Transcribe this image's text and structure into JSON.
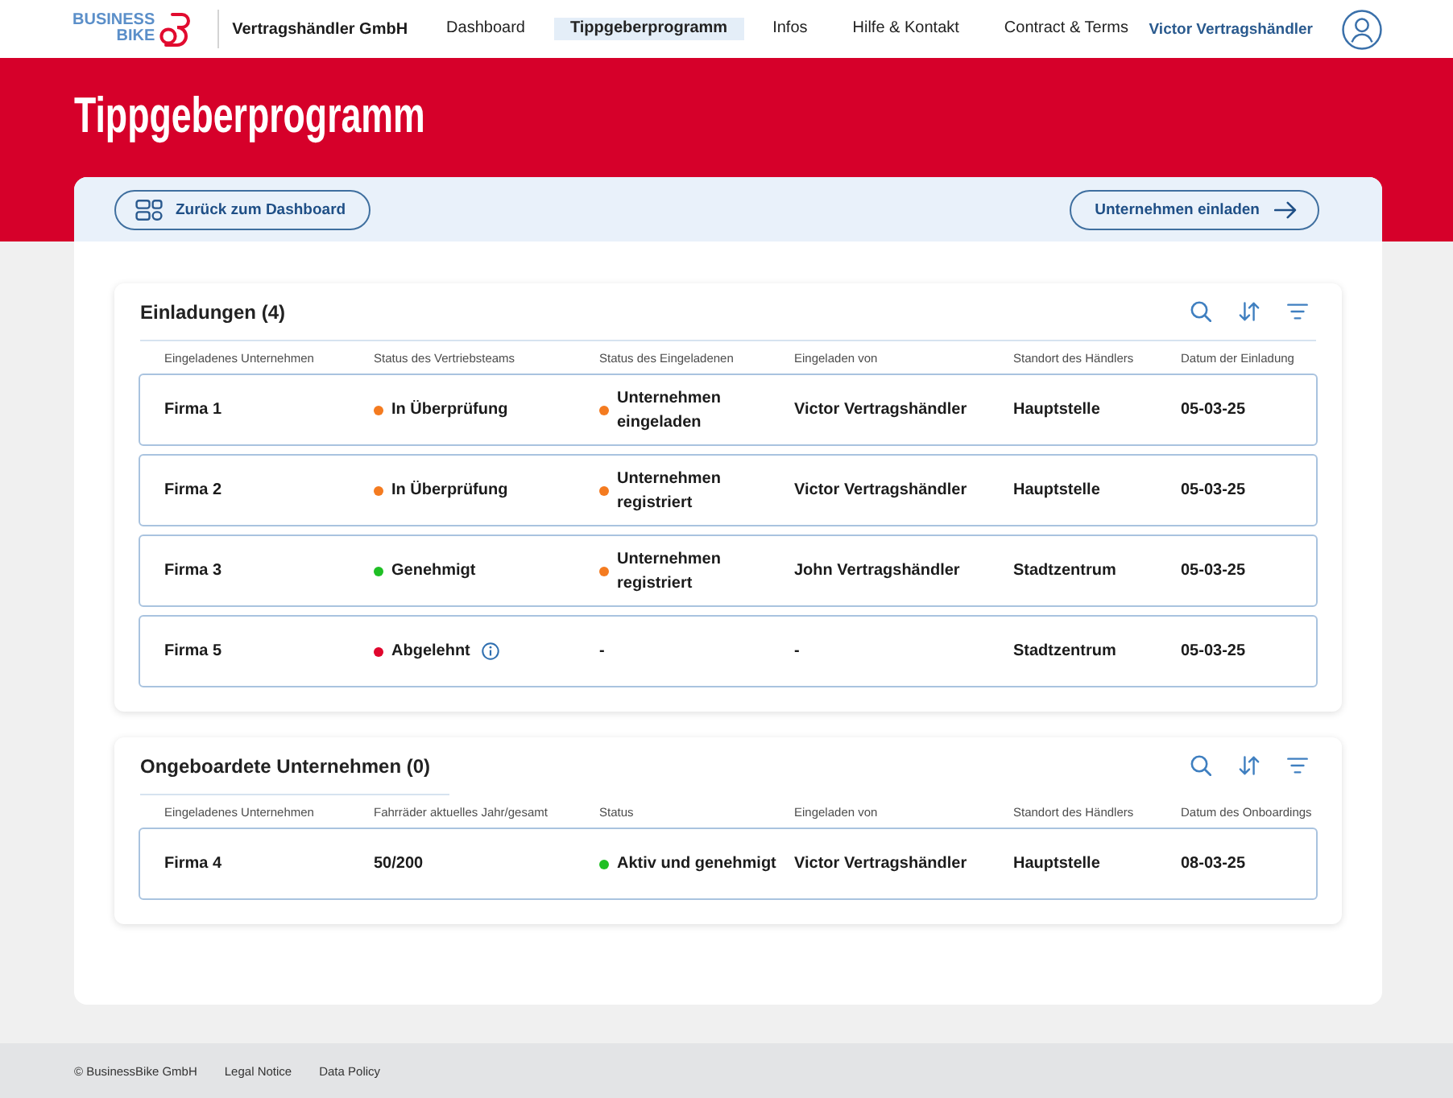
{
  "header": {
    "logo": {
      "lines": [
        "BUSINESS",
        "BIKE"
      ]
    },
    "company": "Vertragshändler GmbH",
    "nav": [
      {
        "label": "Dashboard",
        "selected": false
      },
      {
        "label": "Tippgeberprogramm",
        "selected": true
      },
      {
        "label": "Infos",
        "selected": false
      },
      {
        "label": "Hilfe & Kontakt",
        "selected": false
      },
      {
        "label": "Contract & Terms",
        "selected": false
      }
    ],
    "user": "Victor Vertragshändler"
  },
  "page_title": "Tippgeberprogramm",
  "toolbar": {
    "back_button": "Zurück zum Dashboard",
    "invite_button": "Unternehmen einladen"
  },
  "sections": [
    {
      "title": "Einladungen (4)",
      "columns": [
        "Eingeladenes Unternehmen",
        "Status des Vertriebsteams",
        "Status des Eingeladenen",
        "Eingeladen von",
        "Standort des Händlers",
        "Datum der Einladung"
      ],
      "rows": [
        {
          "cells": [
            {
              "kind": "text",
              "text": "Firma 1"
            },
            {
              "kind": "status",
              "text": "In Überprüfung",
              "color": "#f47b20",
              "info": false
            },
            {
              "kind": "status",
              "text": "Unternehmen eingeladen",
              "color": "#f47b20",
              "info": false
            },
            {
              "kind": "text",
              "text": "Victor Vertragshändler"
            },
            {
              "kind": "text",
              "text": "Hauptstelle"
            },
            {
              "kind": "text",
              "text": "05-03-25"
            }
          ]
        },
        {
          "cells": [
            {
              "kind": "text",
              "text": "Firma 2"
            },
            {
              "kind": "status",
              "text": "In Überprüfung",
              "color": "#f47b20",
              "info": false
            },
            {
              "kind": "status",
              "text": "Unternehmen registriert",
              "color": "#f47b20",
              "info": false
            },
            {
              "kind": "text",
              "text": "Victor Vertragshändler"
            },
            {
              "kind": "text",
              "text": "Hauptstelle"
            },
            {
              "kind": "text",
              "text": "05-03-25"
            }
          ]
        },
        {
          "cells": [
            {
              "kind": "text",
              "text": "Firma 3"
            },
            {
              "kind": "status",
              "text": "Genehmigt",
              "color": "#1fbf24",
              "info": false
            },
            {
              "kind": "status",
              "text": "Unternehmen registriert",
              "color": "#f47b20",
              "info": false
            },
            {
              "kind": "text",
              "text": "John Vertragshändler"
            },
            {
              "kind": "text",
              "text": "Stadtzentrum"
            },
            {
              "kind": "text",
              "text": "05-03-25"
            }
          ]
        },
        {
          "cells": [
            {
              "kind": "text",
              "text": "Firma 5"
            },
            {
              "kind": "status",
              "text": "Abgelehnt",
              "color": "#e0062d",
              "info": true
            },
            {
              "kind": "text",
              "text": "-"
            },
            {
              "kind": "text",
              "text": "-"
            },
            {
              "kind": "text",
              "text": "Stadtzentrum"
            },
            {
              "kind": "text",
              "text": "05-03-25"
            }
          ]
        }
      ]
    },
    {
      "title": "Ongeboardete Unternehmen (0)",
      "columns": [
        "Eingeladenes Unternehmen",
        "Fahrräder aktuelles Jahr/gesamt",
        "Status",
        "Eingeladen von",
        "Standort des Händlers",
        "Datum des Onboardings"
      ],
      "rows": [
        {
          "cells": [
            {
              "kind": "text",
              "text": "Firma 4"
            },
            {
              "kind": "text",
              "text": "50/200"
            },
            {
              "kind": "status",
              "text": "Aktiv und genehmigt",
              "color": "#1fbf24",
              "info": false
            },
            {
              "kind": "text",
              "text": "Victor Vertragshändler"
            },
            {
              "kind": "text",
              "text": "Hauptstelle"
            },
            {
              "kind": "text",
              "text": "08-03-25"
            }
          ]
        }
      ]
    }
  ],
  "footer": {
    "copyright": "© BusinessBike GmbH",
    "links": [
      "Legal Notice",
      "Data Policy"
    ]
  }
}
